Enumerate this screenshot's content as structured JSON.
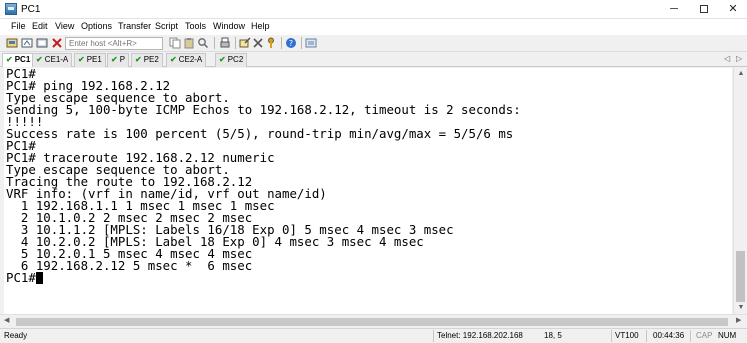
{
  "window": {
    "title": "PC1",
    "min_glyph": "─",
    "close_glyph": "✕"
  },
  "menu": [
    "File",
    "Edit",
    "View",
    "Options",
    "Transfer",
    "Script",
    "Tools",
    "Window",
    "Help"
  ],
  "toolbar": {
    "host_placeholder": "Enter host <Alt+R>"
  },
  "tabs": [
    {
      "label": "PC1",
      "active": true
    },
    {
      "label": "CE1-A",
      "active": false
    },
    {
      "label": "PE1",
      "active": false
    },
    {
      "label": "P",
      "active": false
    },
    {
      "label": "PE2",
      "active": false
    },
    {
      "label": "CE2-A",
      "active": false
    },
    {
      "label": "PC2",
      "active": false
    }
  ],
  "tab_check_glyph": "✔",
  "tab_nav": {
    "left": "◁",
    "right": "▷"
  },
  "terminal": {
    "lines": [
      "PC1#",
      "PC1# ping 192.168.2.12",
      "Type escape sequence to abort.",
      "Sending 5, 100-byte ICMP Echos to 192.168.2.12, timeout is 2 seconds:",
      "!!!!!",
      "Success rate is 100 percent (5/5), round-trip min/avg/max = 5/5/6 ms",
      "PC1#",
      "PC1# traceroute 192.168.2.12 numeric",
      "Type escape sequence to abort.",
      "Tracing the route to 192.168.2.12",
      "VRF info: (vrf in name/id, vrf out name/id)",
      "  1 192.168.1.1 1 msec 1 msec 1 msec",
      "  2 10.1.0.2 2 msec 2 msec 2 msec",
      "  3 10.1.1.2 [MPLS: Labels 16/18 Exp 0] 5 msec 4 msec 3 msec",
      "  4 10.2.0.2 [MPLS: Label 18 Exp 0] 4 msec 3 msec 4 msec",
      "  5 10.2.0.1 5 msec 4 msec 4 msec",
      "  6 192.168.2.12 5 msec *  6 msec"
    ],
    "prompt": "PC1#"
  },
  "status": {
    "ready": "Ready",
    "connection": "Telnet: 192.168.202.168",
    "position": "18,  5",
    "emulation": "VT100",
    "time": "00:44:36",
    "cap": "CAP",
    "num": "NUM"
  },
  "colors": {
    "terminal_bg": "#ffffff",
    "terminal_fg": "#000000",
    "check": "#1f9a1f"
  }
}
